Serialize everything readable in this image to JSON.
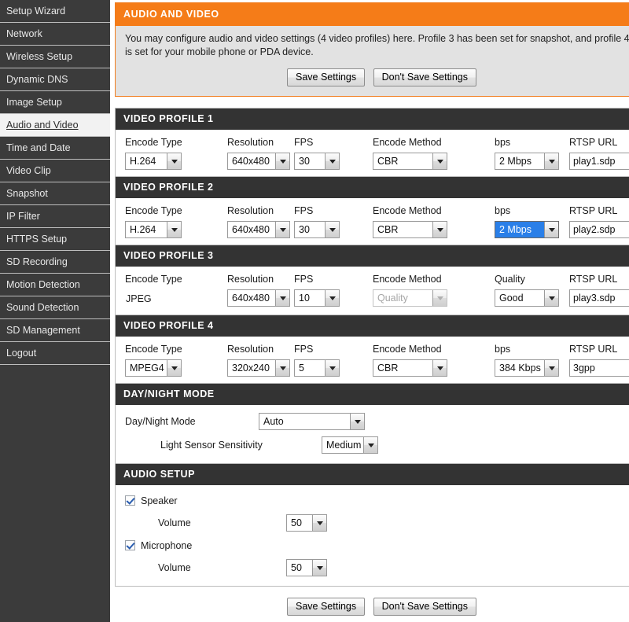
{
  "sidebar": {
    "items": [
      {
        "label": "Setup Wizard",
        "active": false
      },
      {
        "label": "Network",
        "active": false
      },
      {
        "label": "Wireless Setup",
        "active": false
      },
      {
        "label": "Dynamic DNS",
        "active": false
      },
      {
        "label": "Image Setup",
        "active": false
      },
      {
        "label": "Audio and Video",
        "active": true
      },
      {
        "label": "Time and Date",
        "active": false
      },
      {
        "label": "Video Clip",
        "active": false
      },
      {
        "label": "Snapshot",
        "active": false
      },
      {
        "label": "IP Filter",
        "active": false
      },
      {
        "label": "HTTPS Setup",
        "active": false
      },
      {
        "label": "SD Recording",
        "active": false
      },
      {
        "label": "Motion Detection",
        "active": false
      },
      {
        "label": "Sound Detection",
        "active": false
      },
      {
        "label": "SD Management",
        "active": false
      },
      {
        "label": "Logout",
        "active": false
      }
    ]
  },
  "intro": {
    "title": "AUDIO AND VIDEO",
    "description": "You may configure audio and video settings (4 video profiles) here. Profile 3 has been set for snapshot, and profile 4 is set for your mobile phone or PDA device.",
    "save_label": "Save Settings",
    "dont_save_label": "Don't Save Settings"
  },
  "columns": {
    "encode_type": "Encode Type",
    "resolution": "Resolution",
    "fps": "FPS",
    "encode_method": "Encode Method",
    "bps": "bps",
    "quality": "Quality",
    "rtsp_url": "RTSP URL"
  },
  "profiles": [
    {
      "title": "VIDEO PROFILE 1",
      "encode_type": "H.264",
      "encode_type_is_select": true,
      "resolution": "640x480",
      "fps": "30",
      "encode_method": "CBR",
      "encode_method_disabled": false,
      "rate_label": "bps",
      "rate_value": "2 Mbps",
      "rate_focused": false,
      "rtsp_url": "play1.sdp"
    },
    {
      "title": "VIDEO PROFILE 2",
      "encode_type": "H.264",
      "encode_type_is_select": true,
      "resolution": "640x480",
      "fps": "30",
      "encode_method": "CBR",
      "encode_method_disabled": false,
      "rate_label": "bps",
      "rate_value": "2 Mbps",
      "rate_focused": true,
      "rtsp_url": "play2.sdp"
    },
    {
      "title": "VIDEO PROFILE 3",
      "encode_type": "JPEG",
      "encode_type_is_select": false,
      "resolution": "640x480",
      "fps": "10",
      "encode_method": "Quality",
      "encode_method_disabled": true,
      "rate_label": "Quality",
      "rate_value": "Good",
      "rate_focused": false,
      "rtsp_url": "play3.sdp"
    },
    {
      "title": "VIDEO PROFILE 4",
      "encode_type": "MPEG4",
      "encode_type_is_select": true,
      "resolution": "320x240",
      "fps": "5",
      "encode_method": "CBR",
      "encode_method_disabled": false,
      "rate_label": "bps",
      "rate_value": "384 Kbps",
      "rate_focused": false,
      "rtsp_url": "3gpp"
    }
  ],
  "daynight": {
    "title": "DAY/NIGHT MODE",
    "mode_label": "Day/Night Mode",
    "mode_value": "Auto",
    "sensitivity_label": "Light Sensor Sensitivity",
    "sensitivity_value": "Medium"
  },
  "audio": {
    "title": "AUDIO SETUP",
    "speaker_label": "Speaker",
    "speaker_checked": true,
    "speaker_volume_label": "Volume",
    "speaker_volume_value": "50",
    "microphone_label": "Microphone",
    "microphone_checked": true,
    "microphone_volume_label": "Volume",
    "microphone_volume_value": "50"
  },
  "footer": {
    "save_label": "Save Settings",
    "dont_save_label": "Don't Save Settings"
  },
  "colors": {
    "accent_orange": "#f57c18",
    "section_dark": "#333333",
    "sidebar_bg": "#3b3b3b",
    "select_highlight": "#2a7fe8"
  }
}
